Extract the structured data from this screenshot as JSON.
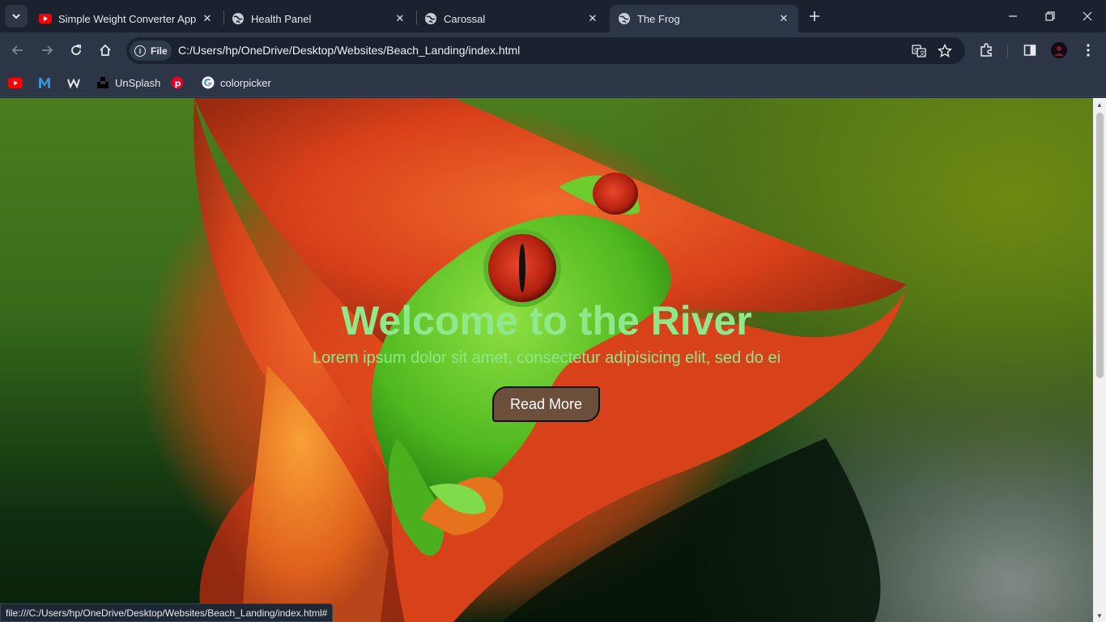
{
  "browser": {
    "tabs": [
      {
        "title": "Simple Weight Converter App W",
        "icon": "youtube-icon"
      },
      {
        "title": "Health Panel",
        "icon": "globe-icon"
      },
      {
        "title": "Carossal",
        "icon": "globe-icon"
      },
      {
        "title": "The Frog",
        "icon": "globe-icon",
        "active": true
      }
    ],
    "address": {
      "chip_label": "File",
      "url": "C:/Users/hp/OneDrive/Desktop/Websites/Beach_Landing/index.html"
    },
    "bookmarks": [
      {
        "label": "",
        "icon": "youtube-icon"
      },
      {
        "label": "",
        "icon": "m-logo-icon"
      },
      {
        "label": "",
        "icon": "w-logo-icon"
      },
      {
        "label": "UnSplash",
        "icon": "unsplash-icon"
      },
      {
        "label": "",
        "icon": "pinterest-icon"
      },
      {
        "label": "colorpicker",
        "icon": "google-icon"
      }
    ],
    "status_url": "file:///C:/Users/hp/OneDrive/Desktop/Websites/Beach_Landing/index.html#"
  },
  "page": {
    "hero": {
      "title": "Welcome to the River",
      "subtitle": "Lorem ipsum dolor sit amet, consectetur adipisicing elit, sed do ei",
      "button_label": "Read More"
    }
  },
  "colors": {
    "tab_strip": "#1a2230",
    "toolbar": "#2c3646",
    "hero_text": "#8fe88a",
    "button_bg": "#6b4f3a"
  }
}
